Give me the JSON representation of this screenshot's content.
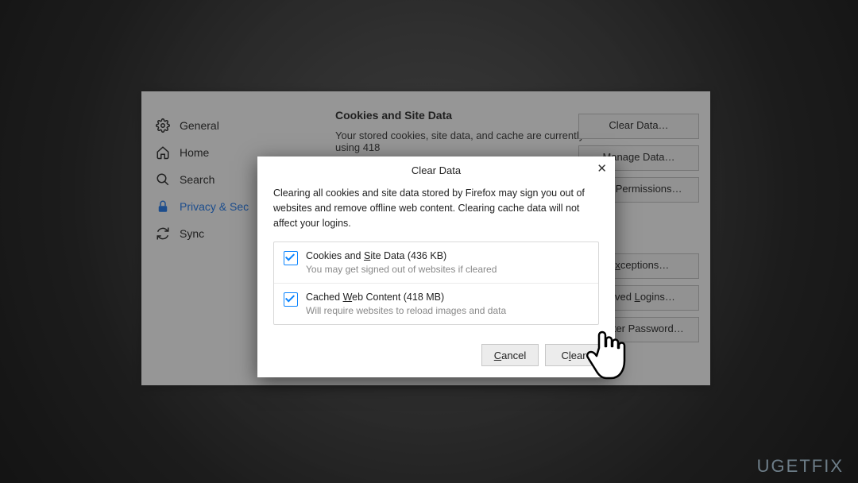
{
  "sidebar": {
    "items": [
      {
        "label": "General"
      },
      {
        "label": "Home"
      },
      {
        "label": "Search"
      },
      {
        "label": "Privacy & Sec"
      },
      {
        "label": "Sync"
      }
    ]
  },
  "content": {
    "heading": "Cookies and Site Data",
    "description": "Your stored cookies, site data, and cache are currently using 418"
  },
  "buttons": {
    "clear_data": "Clear Data…",
    "manage_data": "Manage Data…",
    "manage_permissions": "age Permissions…",
    "exceptions": "Exceptions…",
    "saved_logins": "Saved Logins…",
    "master_password": "Master Password…"
  },
  "dialog": {
    "title": "Clear Data",
    "intro": "Clearing all cookies and site data stored by Firefox may sign you out of websites and remove offline web content. Clearing cache data will not affect your logins.",
    "options": [
      {
        "label": "Cookies and Site Data (436 KB)",
        "sub": "You may get signed out of websites if cleared"
      },
      {
        "label": "Cached Web Content (418 MB)",
        "sub": "Will require websites to reload images and data"
      }
    ],
    "cancel": "Cancel",
    "clear": "Clear"
  },
  "watermark": "UGETFIX"
}
